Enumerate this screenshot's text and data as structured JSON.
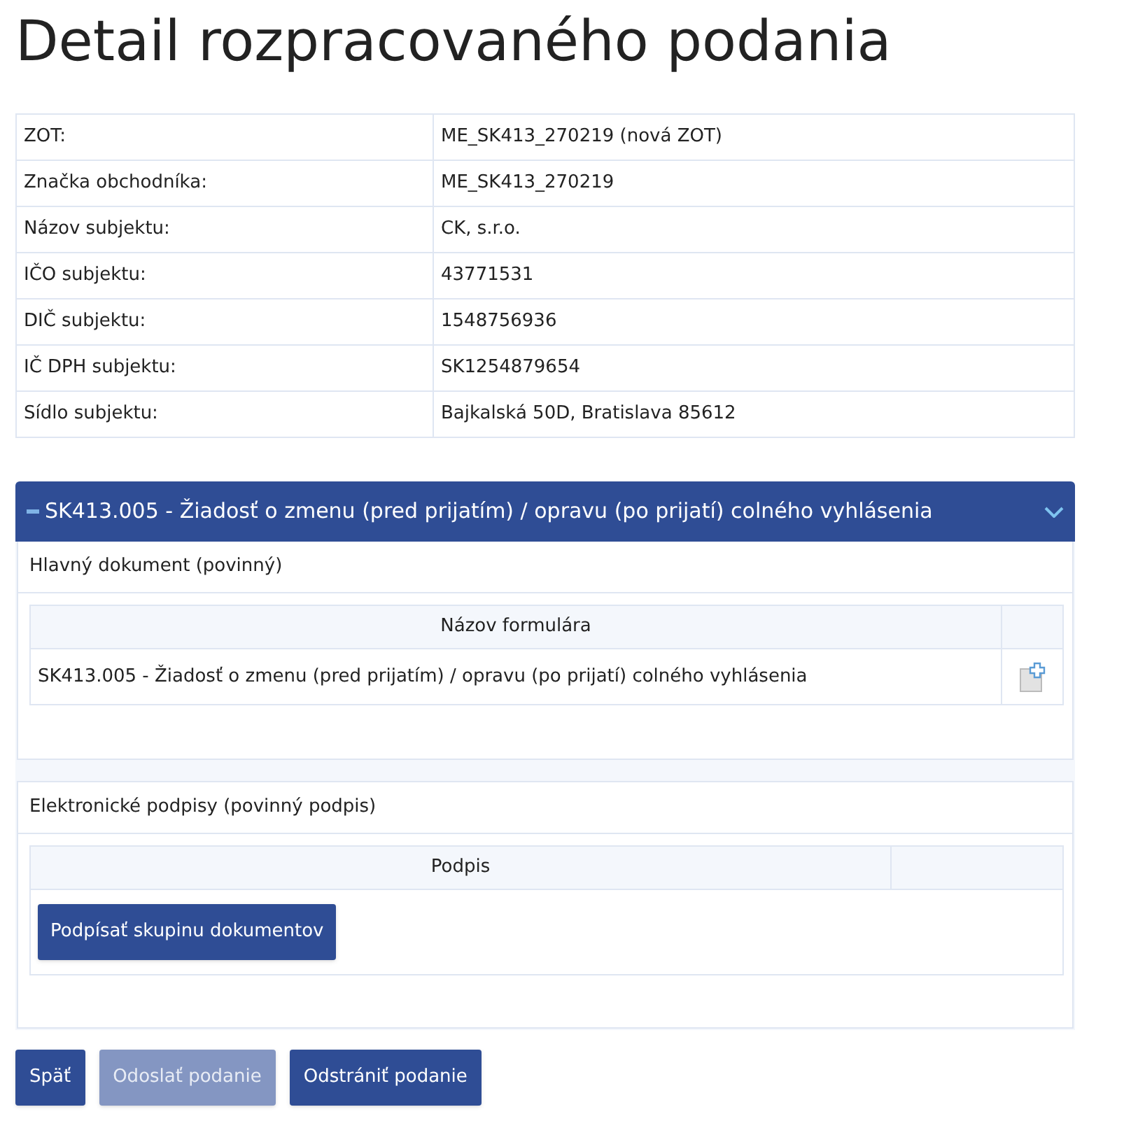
{
  "title": "Detail rozpracovaného podania",
  "details": [
    {
      "label": "ZOT:",
      "value": "ME_SK413_270219 (nová ZOT)"
    },
    {
      "label": "Značka obchodníka:",
      "value": "ME_SK413_270219"
    },
    {
      "label": "Názov subjektu:",
      "value": "CK, s.r.o."
    },
    {
      "label": "IČO subjektu:",
      "value": "43771531"
    },
    {
      "label": "DIČ subjektu:",
      "value": "1548756936"
    },
    {
      "label": "IČ DPH subjektu:",
      "value": "SK1254879654"
    },
    {
      "label": "Sídlo subjektu:",
      "value": "Bajkalská 50D, Bratislava 85612"
    }
  ],
  "panel": {
    "title": "SK413.005 - Žiadosť o zmenu (pred prijatím) / opravu (po prijatí) colného vyhlásenia",
    "expanded": true,
    "main_document": {
      "heading": "Hlavný dokument (povinný)",
      "column": "Názov formulára",
      "rows": [
        {
          "name": "SK413.005 - Žiadosť o zmenu (pred prijatím) / opravu (po prijatí) colného vyhlásenia"
        }
      ]
    },
    "signatures": {
      "heading": "Elektronické podpisy (povinný podpis)",
      "column": "Podpis",
      "button": "Podpísať skupinu dokumentov"
    }
  },
  "buttons": [
    {
      "label": "Späť",
      "disabled": false
    },
    {
      "label": "Odoslať podanie",
      "disabled": true
    },
    {
      "label": "Odstrániť podanie",
      "disabled": false
    }
  ]
}
